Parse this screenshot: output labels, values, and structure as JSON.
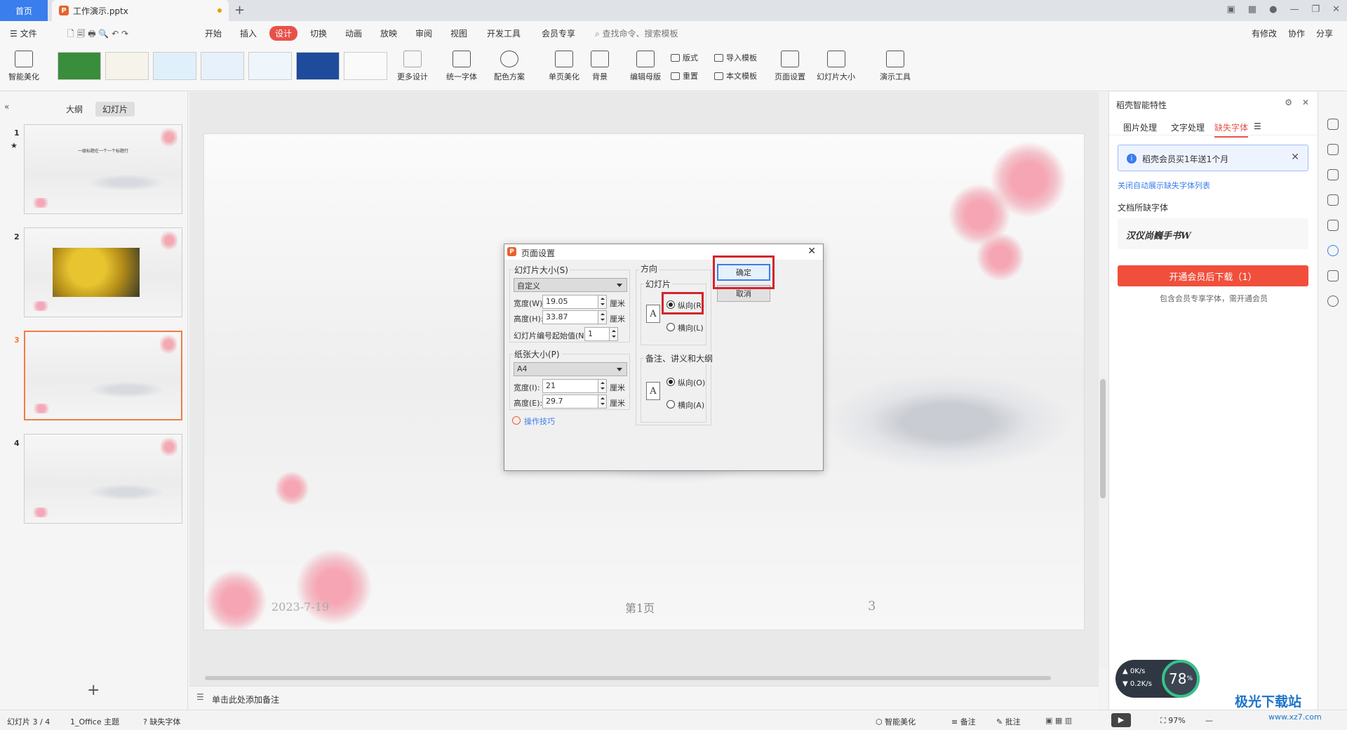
{
  "tabs": {
    "home": "首页",
    "doc": "工作演示.pptx"
  },
  "menu": {
    "items": [
      "文件",
      "开始",
      "插入",
      "设计",
      "切换",
      "动画",
      "放映",
      "审阅",
      "视图",
      "开发工具",
      "会员专享"
    ],
    "search": "查找命令、搜索模板",
    "right": [
      "有修改",
      "协作",
      "分享"
    ]
  },
  "ribbon": {
    "smart": "智能美化",
    "more": "更多设计",
    "unify_font": "统一字体",
    "color_scheme": "配色方案",
    "single_beautify": "单页美化",
    "background": "背景",
    "edit_master": "编辑母版",
    "layout": "版式",
    "reset": "重置",
    "import_tpl": "导入模板",
    "text_tpl": "本文模板",
    "page_setup": "页面设置",
    "slide_size": "幻灯片大小",
    "tools": "演示工具"
  },
  "left": {
    "tab_outline": "大纲",
    "tab_slides": "幻灯片",
    "slides": [
      "1",
      "2",
      "3",
      "4"
    ],
    "slide1_title": "一级标题在一个一个标题行"
  },
  "slide": {
    "date": "2023-7-19",
    "footer": "第1页",
    "number": "3"
  },
  "notes": "单击此处添加备注",
  "status": {
    "slide_pos": "幻灯片 3 / 4",
    "theme": "1_Office 主题",
    "missing_font": "缺失字体",
    "smart": "智能美化",
    "notes": "备注",
    "comments": "批注",
    "zoom": "97%"
  },
  "right": {
    "title": "稻壳智能特性",
    "tabs": [
      "图片处理",
      "文字处理",
      "缺失字体"
    ],
    "promo": "稻壳会员买1年送1个月",
    "link": "关闭自动展示缺失字体列表",
    "doc_fonts": "文档所缺字体",
    "font_name": "汉仪尚巍手书W",
    "download": "开通会员后下载（1）",
    "note": "包含会员专享字体，需开通会员"
  },
  "speed": {
    "up": "0K/s",
    "down": "0.2K/s",
    "cpu": "78"
  },
  "watermark": {
    "name": "极光下载站",
    "url": "www.xz7.com"
  },
  "dialog": {
    "title": "页面设置",
    "slide_size_group": "幻灯片大小(S)",
    "slide_size_value": "自定义",
    "width_label": "宽度(W):",
    "width_value": "19.05",
    "height_label": "高度(H):",
    "height_value": "33.87",
    "unit": "厘米",
    "start_label": "幻灯片编号起始值(N):",
    "start_value": "1",
    "paper_group": "纸张大小(P)",
    "paper_value": "A4",
    "pwidth_label": "宽度(I):",
    "pwidth_value": "21",
    "pheight_label": "高度(E):",
    "pheight_value": "29.7",
    "tips": "操作技巧",
    "orient_group": "方向",
    "slides_group": "幻灯片",
    "portrait_r": "纵向(R)",
    "landscape_l": "横向(L)",
    "notes_group": "备注、讲义和大纲",
    "portrait_o": "纵向(O)",
    "landscape_a": "横向(A)",
    "ok": "确定",
    "cancel": "取消"
  }
}
